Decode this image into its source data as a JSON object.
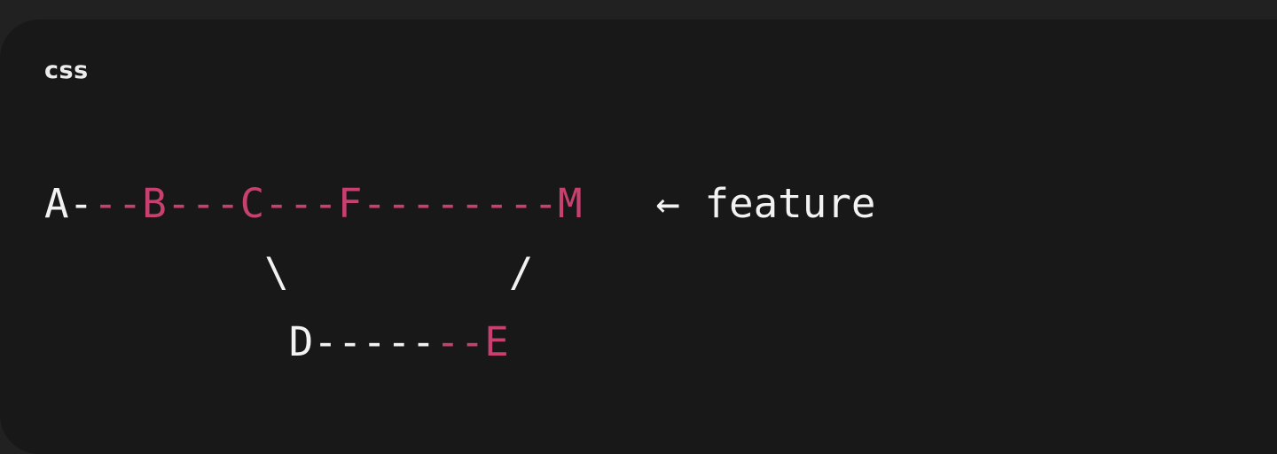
{
  "code_block": {
    "language": "css",
    "accent_color": "#c8406f",
    "lines": [
      [
        {
          "t": "A-",
          "c": "plain"
        },
        {
          "t": "--B---C---F--------M",
          "c": "accent"
        },
        {
          "t": "   ← feature",
          "c": "plain"
        }
      ],
      [
        {
          "t": "         \\         /",
          "c": "plain"
        }
      ],
      [
        {
          "t": "          D-----",
          "c": "plain"
        },
        {
          "t": "--E",
          "c": "accent"
        }
      ]
    ]
  }
}
